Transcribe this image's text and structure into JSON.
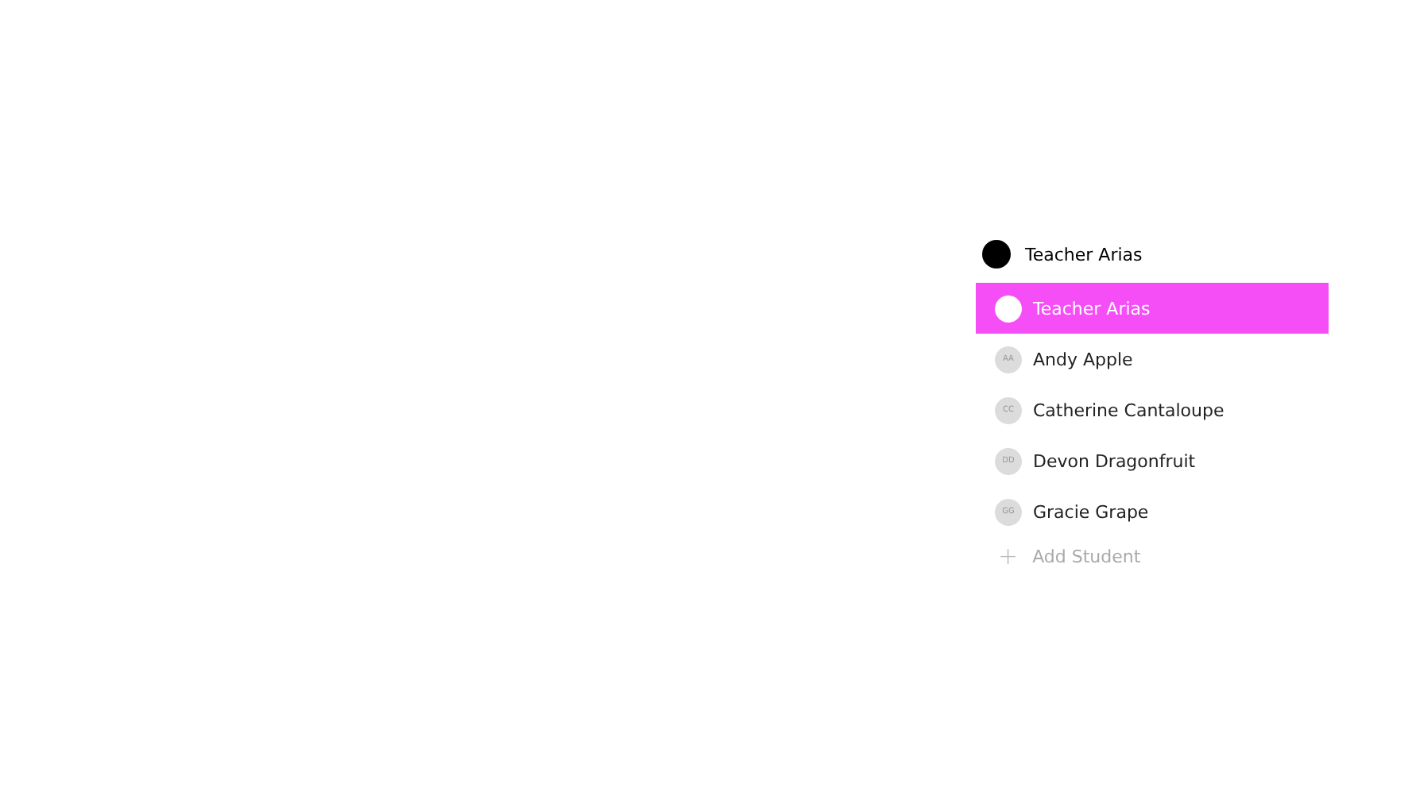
{
  "header": {
    "name": "Teacher Arias"
  },
  "members": [
    {
      "name": "Teacher Arias",
      "selected": true
    },
    {
      "name": "Andy Apple",
      "initials": "AA",
      "selected": false
    },
    {
      "name": "Catherine Cantaloupe",
      "initials": "CC",
      "selected": false
    },
    {
      "name": "Devon Dragonfruit",
      "initials": "DD",
      "selected": false
    },
    {
      "name": "Gracie Grape",
      "initials": "GG",
      "selected": false
    }
  ],
  "add_button": {
    "label": "Add Student",
    "icon": "+"
  }
}
